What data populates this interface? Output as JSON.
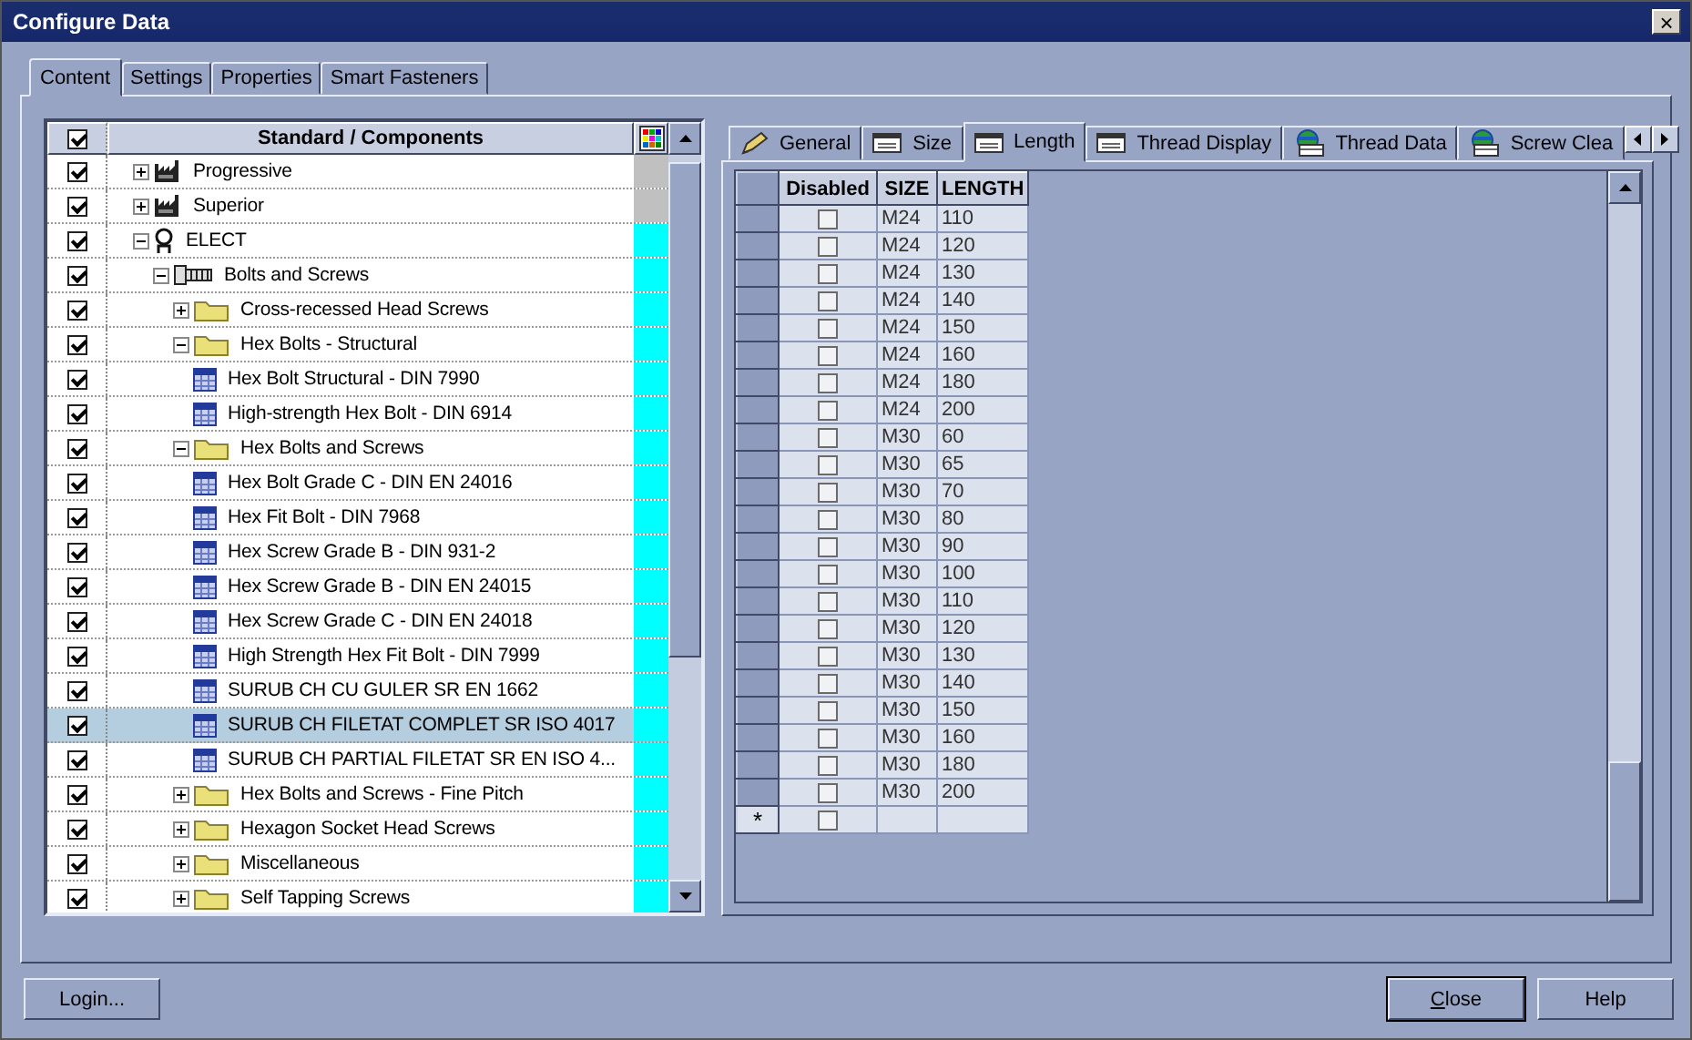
{
  "window": {
    "title": "Configure Data",
    "close": "×"
  },
  "tabs": [
    {
      "label": "Content",
      "selected": true
    },
    {
      "label": "Settings",
      "selected": false
    },
    {
      "label": "Properties",
      "selected": false
    },
    {
      "label": "Smart Fasteners",
      "selected": false
    }
  ],
  "tree": {
    "header_checked": true,
    "column": "Standard / Components",
    "items": [
      {
        "label": "Progressive",
        "kind": "factory",
        "checked": true,
        "expanded": false,
        "selected": false,
        "color": "#c0c0c0"
      },
      {
        "label": "Superior",
        "kind": "factory",
        "checked": true,
        "expanded": false,
        "selected": false,
        "color": "#c0c0c0"
      },
      {
        "label": "ELECT",
        "kind": "person",
        "checked": true,
        "expanded": true,
        "selected": false,
        "color": "#00ffff",
        "children": [
          {
            "label": "Bolts and Screws",
            "kind": "bolt",
            "checked": true,
            "expanded": true,
            "selected": false,
            "color": "#00ffff",
            "children": [
              {
                "label": "Cross-recessed Head Screws",
                "kind": "folder",
                "checked": true,
                "expanded": false,
                "selected": false,
                "color": "#00ffff"
              },
              {
                "label": "Hex Bolts - Structural",
                "kind": "folder",
                "checked": true,
                "expanded": true,
                "selected": false,
                "color": "#00ffff",
                "children": [
                  {
                    "label": "Hex Bolt Structural - DIN 7990",
                    "kind": "table",
                    "checked": true,
                    "selected": false,
                    "color": "#00ffff"
                  },
                  {
                    "label": "High-strength Hex Bolt - DIN 6914",
                    "kind": "table",
                    "checked": true,
                    "selected": false,
                    "color": "#00ffff"
                  }
                ]
              },
              {
                "label": "Hex Bolts and Screws",
                "kind": "folder",
                "checked": true,
                "expanded": true,
                "selected": false,
                "color": "#00ffff",
                "children": [
                  {
                    "label": "Hex Bolt Grade C - DIN EN 24016",
                    "kind": "table",
                    "checked": true,
                    "selected": false,
                    "color": "#00ffff"
                  },
                  {
                    "label": "Hex Fit Bolt  - DIN 7968",
                    "kind": "table",
                    "checked": true,
                    "selected": false,
                    "color": "#00ffff"
                  },
                  {
                    "label": "Hex Screw Grade B - DIN 931-2",
                    "kind": "table",
                    "checked": true,
                    "selected": false,
                    "color": "#00ffff"
                  },
                  {
                    "label": "Hex Screw Grade B - DIN EN 24015",
                    "kind": "table",
                    "checked": true,
                    "selected": false,
                    "color": "#00ffff"
                  },
                  {
                    "label": "Hex Screw Grade C - DIN EN 24018",
                    "kind": "table",
                    "checked": true,
                    "selected": false,
                    "color": "#00ffff"
                  },
                  {
                    "label": "High Strength Hex Fit Bolt  - DIN 7999",
                    "kind": "table",
                    "checked": true,
                    "selected": false,
                    "color": "#00ffff"
                  },
                  {
                    "label": "SURUB CH CU GULER SR EN 1662",
                    "kind": "table",
                    "checked": true,
                    "selected": false,
                    "color": "#00ffff"
                  },
                  {
                    "label": "SURUB CH FILETAT COMPLET SR ISO 4017",
                    "kind": "table",
                    "checked": true,
                    "selected": true,
                    "color": "#00ffff"
                  },
                  {
                    "label": "SURUB CH PARTIAL FILETAT SR EN ISO 4...",
                    "kind": "table",
                    "checked": true,
                    "selected": false,
                    "color": "#00ffff"
                  }
                ]
              },
              {
                "label": "Hex Bolts and Screws - Fine Pitch",
                "kind": "folder",
                "checked": true,
                "expanded": false,
                "selected": false,
                "color": "#00ffff"
              },
              {
                "label": "Hexagon Socket Head Screws",
                "kind": "folder",
                "checked": true,
                "expanded": false,
                "selected": false,
                "color": "#00ffff"
              },
              {
                "label": "Miscellaneous",
                "kind": "folder",
                "checked": true,
                "expanded": false,
                "selected": false,
                "color": "#00ffff"
              },
              {
                "label": "Self Tapping Screws",
                "kind": "folder",
                "checked": true,
                "expanded": false,
                "selected": false,
                "color": "#00ffff"
              }
            ]
          }
        ]
      }
    ]
  },
  "data_tabs": [
    {
      "label": "General",
      "kind": "pencil",
      "selected": false
    },
    {
      "label": "Size",
      "kind": "table",
      "selected": false
    },
    {
      "label": "Length",
      "kind": "table",
      "selected": true
    },
    {
      "label": "Thread Display",
      "kind": "table",
      "selected": false
    },
    {
      "label": "Thread Data",
      "kind": "globe",
      "selected": false
    },
    {
      "label": "Screw Clea",
      "kind": "globe",
      "selected": false
    }
  ],
  "grid": {
    "columns": [
      "Disabled",
      "SIZE",
      "LENGTH"
    ],
    "new_row_marker": "*",
    "new_row_disabled": false,
    "rows": [
      {
        "disabled": false,
        "size": "M24",
        "length": "110"
      },
      {
        "disabled": false,
        "size": "M24",
        "length": "120"
      },
      {
        "disabled": false,
        "size": "M24",
        "length": "130"
      },
      {
        "disabled": false,
        "size": "M24",
        "length": "140"
      },
      {
        "disabled": false,
        "size": "M24",
        "length": "150"
      },
      {
        "disabled": false,
        "size": "M24",
        "length": "160"
      },
      {
        "disabled": false,
        "size": "M24",
        "length": "180"
      },
      {
        "disabled": false,
        "size": "M24",
        "length": "200"
      },
      {
        "disabled": false,
        "size": "M30",
        "length": "60"
      },
      {
        "disabled": false,
        "size": "M30",
        "length": "65"
      },
      {
        "disabled": false,
        "size": "M30",
        "length": "70"
      },
      {
        "disabled": false,
        "size": "M30",
        "length": "80"
      },
      {
        "disabled": false,
        "size": "M30",
        "length": "90"
      },
      {
        "disabled": false,
        "size": "M30",
        "length": "100"
      },
      {
        "disabled": false,
        "size": "M30",
        "length": "110"
      },
      {
        "disabled": false,
        "size": "M30",
        "length": "120"
      },
      {
        "disabled": false,
        "size": "M30",
        "length": "130"
      },
      {
        "disabled": false,
        "size": "M30",
        "length": "140"
      },
      {
        "disabled": false,
        "size": "M30",
        "length": "150"
      },
      {
        "disabled": false,
        "size": "M30",
        "length": "160"
      },
      {
        "disabled": false,
        "size": "M30",
        "length": "180"
      },
      {
        "disabled": false,
        "size": "M30",
        "length": "200"
      }
    ]
  },
  "buttons": [
    {
      "label": "Login...",
      "kind": "left"
    },
    {
      "label": "Close",
      "kind": "default"
    },
    {
      "label": "Help",
      "kind": "normal"
    }
  ]
}
